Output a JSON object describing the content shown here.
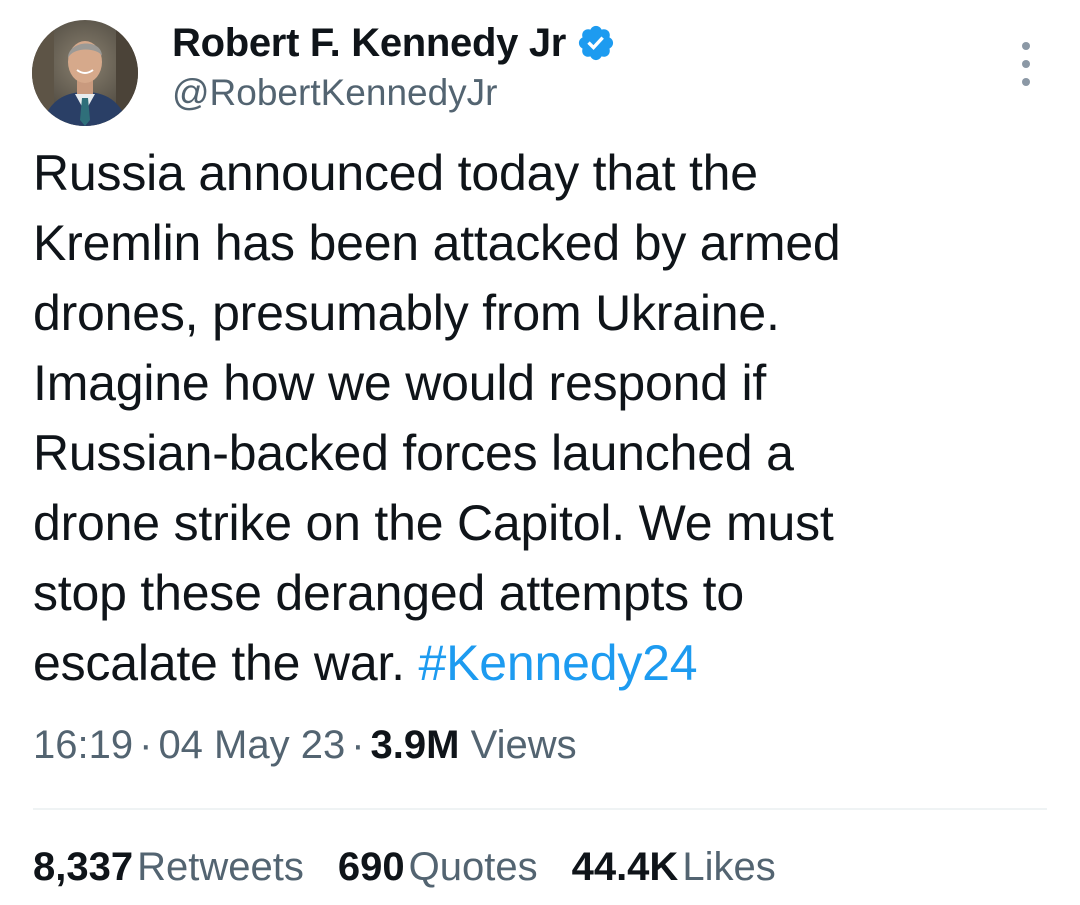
{
  "author": {
    "display_name": "Robert F. Kennedy Jr",
    "handle": "@RobertKennedyJr",
    "verified": true,
    "verified_color": "#1d9bf0"
  },
  "tweet": {
    "lines": [
      "Russia announced today that the",
      "Kremlin has been attacked by armed",
      "drones, presumably from Ukraine.",
      "Imagine how we would respond if",
      "Russian-backed forces launched a",
      "drone strike on the Capitol. We must",
      "stop these deranged attempts to",
      "escalate the war."
    ],
    "hashtag": "#Kennedy24",
    "hashtag_color": "#1d9bf0"
  },
  "meta": {
    "time": "16:19",
    "date": "04 May 23",
    "views_count": "3.9M",
    "views_label": "Views",
    "separator": "·"
  },
  "stats": {
    "retweets_count": "8,337",
    "retweets_label": "Retweets",
    "quotes_count": "690",
    "quotes_label": "Quotes",
    "likes_count": "44.4K",
    "likes_label": "Likes"
  },
  "icons": {
    "verified": "verified-badge-icon",
    "more": "more-options-icon",
    "avatar": "profile-avatar"
  }
}
